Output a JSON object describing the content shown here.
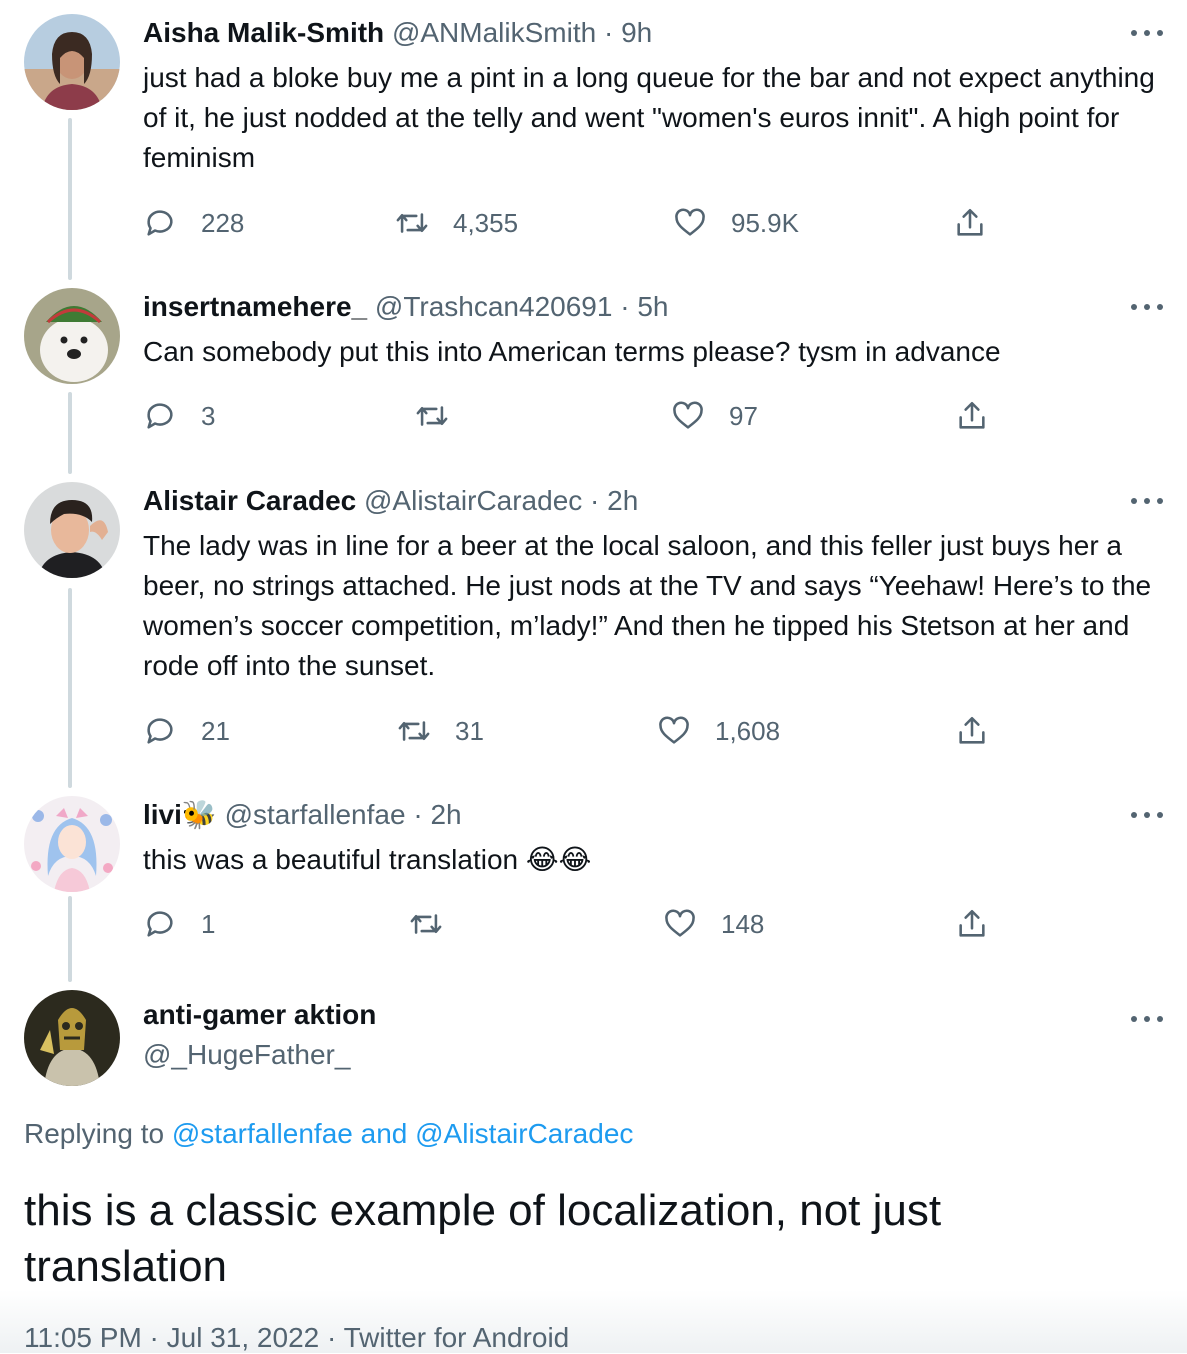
{
  "tweets": [
    {
      "name": "Aisha Malik-Smith",
      "handle": "@ANMalikSmith",
      "time": "9h",
      "body": "just had a bloke buy me a pint in a long queue for the bar and not expect anything of it, he just nodded at the telly and went \"women's euros innit\". A high point for feminism",
      "replies": "228",
      "retweets": "4,355",
      "likes": "95.9K"
    },
    {
      "name": "insertnamehere_",
      "handle": "@Trashcan420691",
      "time": "5h",
      "body": "Can somebody put this into American  terms please? tysm in advance",
      "replies": "3",
      "retweets": "",
      "likes": "97"
    },
    {
      "name": "Alistair Caradec",
      "handle": "@AlistairCaradec",
      "time": "2h",
      "body": "The lady was in line for a beer at the local saloon, and this feller just buys her a beer, no strings attached. He just nods at the TV and says “Yeehaw! Here’s to the women’s soccer competition, m’lady!” And then he tipped his Stetson at her and rode off into the sunset.",
      "replies": "21",
      "retweets": "31",
      "likes": "1,608"
    },
    {
      "name": "livi",
      "name_emoji": "🐝",
      "handle": "@starfallenfae",
      "time": "2h",
      "body": "this was a beautiful translation 😂😂",
      "replies": "1",
      "retweets": "",
      "likes": "148"
    }
  ],
  "main": {
    "name": "anti-gamer aktion",
    "handle": "@_HugeFather_",
    "replying_prefix": "Replying to ",
    "replying_user1": "@starfallenfae",
    "replying_and": " and ",
    "replying_user2": "@AlistairCaradec",
    "text": "this is a classic example of localization, not just translation",
    "timestamp": "11:05 PM · Jul 31, 2022 · Twitter for Android"
  },
  "separator": " · ",
  "icons": [
    "reply-icon",
    "retweet-icon",
    "like-icon",
    "share-icon",
    "more-icon"
  ],
  "colors": {
    "link": "#1d9bf0",
    "secondary": "#536471",
    "thread_line": "#cfd9de"
  }
}
